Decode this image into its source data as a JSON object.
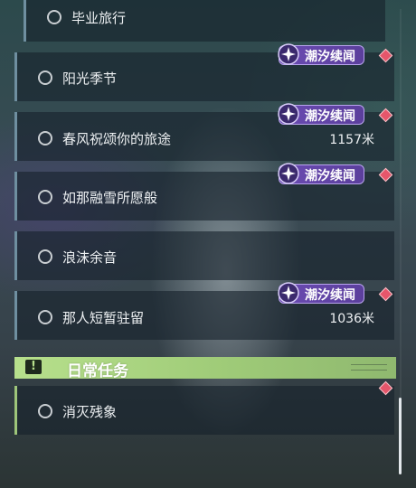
{
  "quests": [
    {
      "title": "毕业旅行",
      "distance": "",
      "tag": ""
    },
    {
      "title": "阳光季节",
      "distance": "",
      "tag": "潮汐续闻"
    },
    {
      "title": "春风祝颂你的旅途",
      "distance": "1157米",
      "tag": "潮汐续闻"
    },
    {
      "title": "如那融雪所愿般",
      "distance": "",
      "tag": "潮汐续闻"
    },
    {
      "title": "浪沫余音",
      "distance": "",
      "tag": ""
    },
    {
      "title": "那人短暂驻留",
      "distance": "1036米",
      "tag": "潮汐续闻"
    }
  ],
  "daily_section": {
    "title": "日常任务",
    "icon": "exclamation-icon",
    "quests": [
      {
        "title": "消灭残象",
        "distance": ""
      }
    ]
  },
  "colors": {
    "tag_purple": "#6a4bb2",
    "daily_green": "#b7e08c",
    "marker_red": "#e5566b"
  },
  "icons": {
    "tag": "sparkle-badge-icon",
    "marker": "diamond-marker-icon",
    "status": "circle-status-icon"
  }
}
